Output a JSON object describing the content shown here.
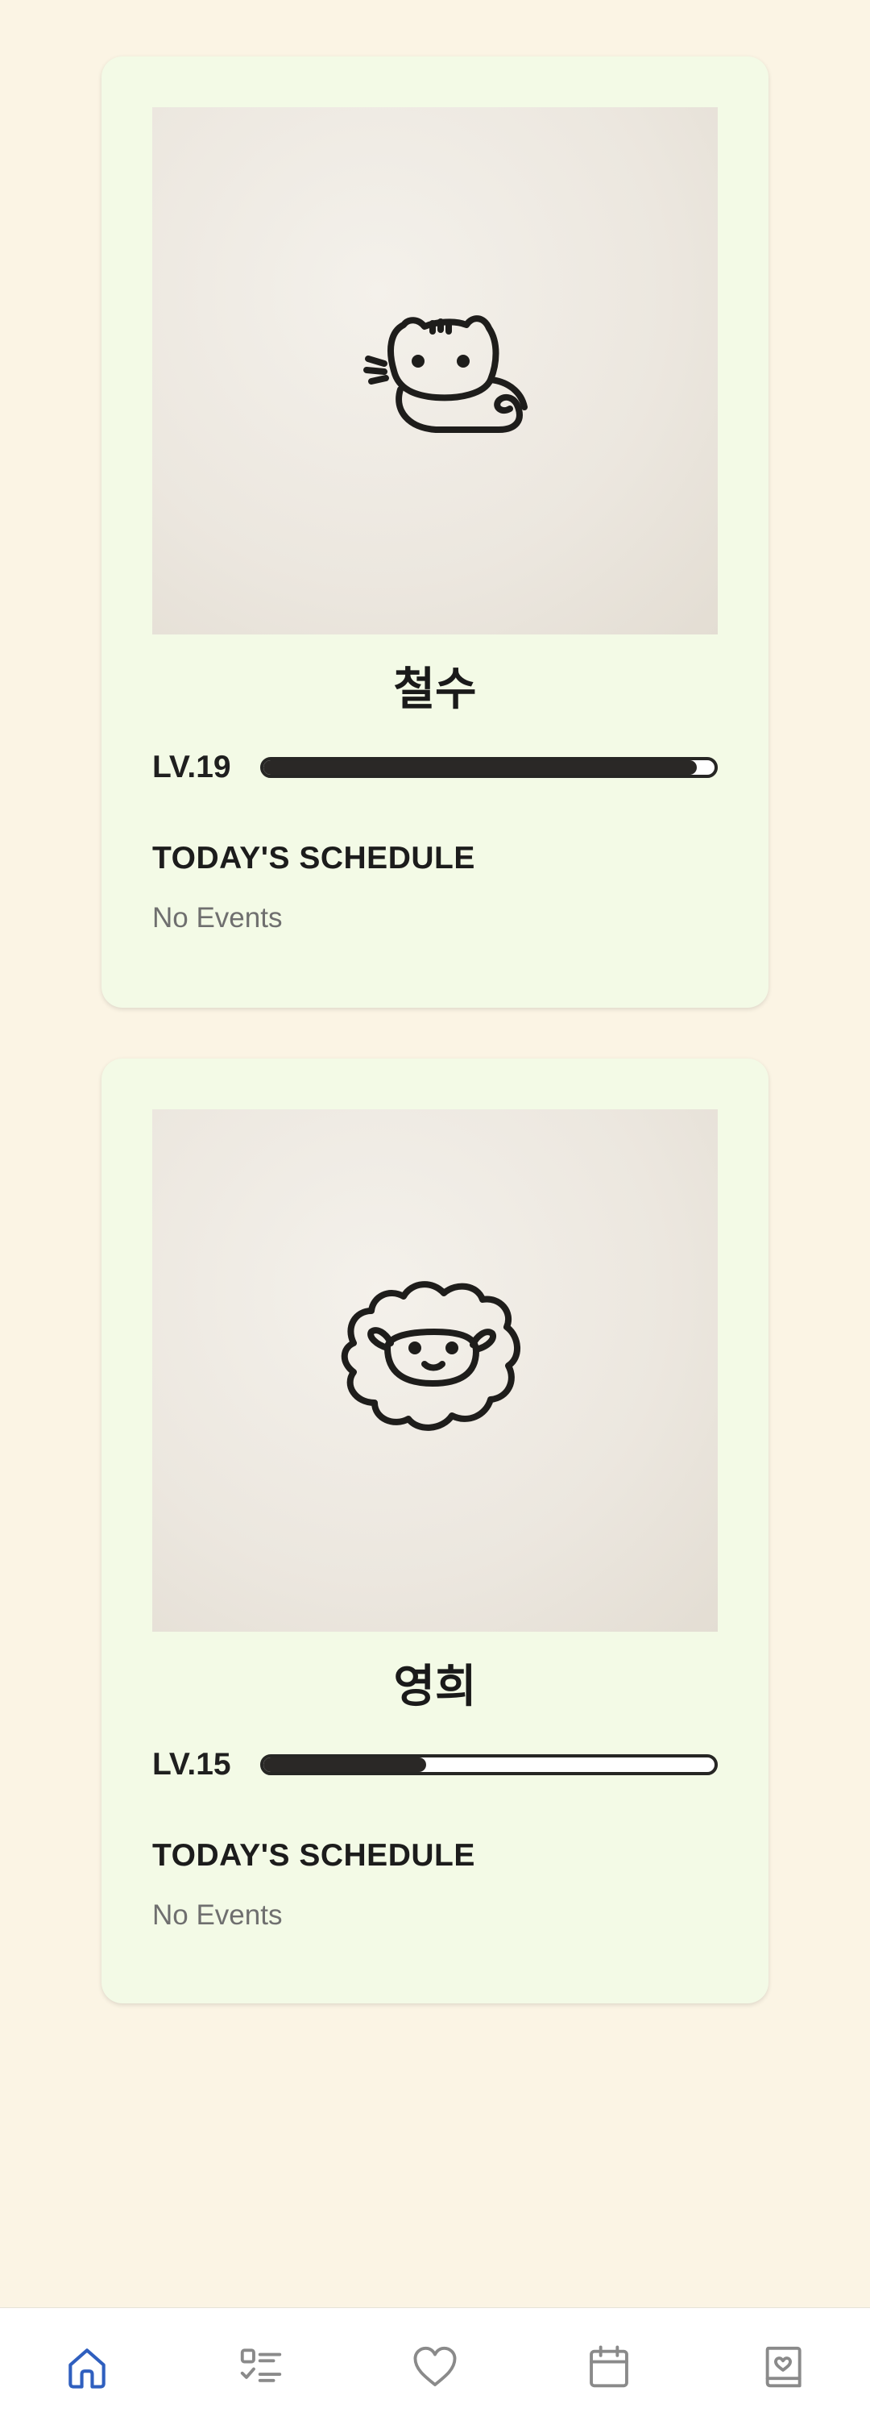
{
  "pets": [
    {
      "name": "철수",
      "level": "LV.19",
      "progress": 0.96,
      "schedule_title": "TODAY'S SCHEDULE",
      "schedule_empty": "No Events",
      "image": "cat-doodle"
    },
    {
      "name": "영희",
      "level": "LV.15",
      "progress": 0.36,
      "schedule_title": "TODAY'S SCHEDULE",
      "schedule_empty": "No Events",
      "image": "sheep-doodle"
    }
  ],
  "nav": {
    "items": [
      {
        "icon": "home-icon",
        "active": true
      },
      {
        "icon": "checklist-icon",
        "active": false
      },
      {
        "icon": "heart-icon",
        "active": false
      },
      {
        "icon": "calendar-icon",
        "active": false
      },
      {
        "icon": "diary-icon",
        "active": false
      }
    ]
  },
  "colors": {
    "background": "#FBF4E4",
    "card": "#F3FAE6",
    "nav_active": "#2F5FBF",
    "nav_inactive": "#8A8A8A",
    "bar": "#2A2826"
  }
}
